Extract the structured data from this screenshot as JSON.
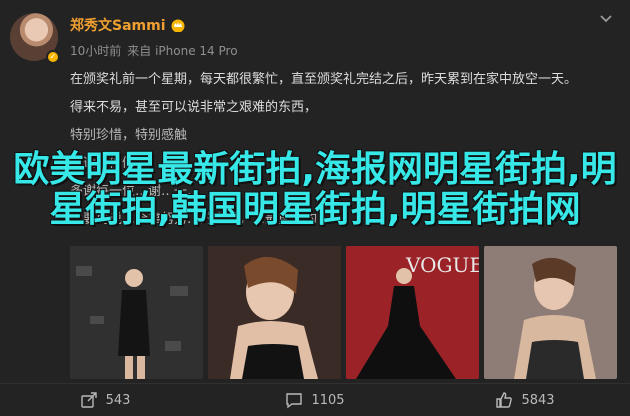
{
  "post": {
    "author": "郑秀文Sammi",
    "time": "10小时前",
    "source": "来自 iPhone 14 Pro",
    "lines": [
      "在颁奖礼前一个星期，每天都很繁忙，直至颁奖礼完结之后，昨天累到在家中放空一天。",
      "得来不易，甚至可以说非常之艰难的东西，",
      "特别珍惜，特别感触",
      "永远爱你们",
      "多谢每一位…谢…一…",
      "不要再说…全靠努力…的辛苦，…最重要的"
    ]
  },
  "overlay": {
    "title": "欧美明星最新街拍,海报网明星街拍,明星街拍,韩国明星街拍,明星街拍网"
  },
  "actions": {
    "share": "543",
    "comments": "1105",
    "likes": "5843"
  },
  "icons": {
    "menu": "chevron-down-icon",
    "crown": "crown-icon",
    "share": "share-icon",
    "comment": "comment-icon",
    "like": "like-icon"
  },
  "colors": {
    "author": "#f0a030",
    "overlay": "#37e8e8",
    "background": "#232323"
  }
}
